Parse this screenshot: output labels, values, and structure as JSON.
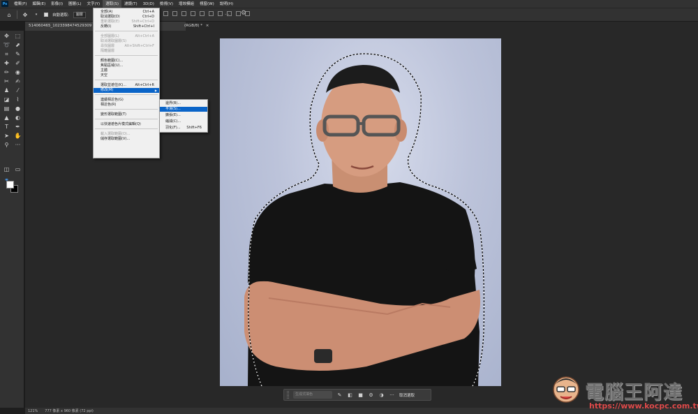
{
  "app": {
    "logo": "Ps"
  },
  "menubar": {
    "items": [
      "檔案(F)",
      "編輯(E)",
      "影像(I)",
      "圖層(L)",
      "文字(Y)",
      "選取(S)",
      "濾鏡(T)",
      "3D(D)",
      "檢視(V)",
      "增效模組",
      "視窗(W)",
      "說明(H)"
    ]
  },
  "options": {
    "auto_select_label": "自動選取:",
    "auto_select_value": "圖層"
  },
  "document": {
    "tab_title": "514060465_1023398474529309 4_7",
    "tab_suffix": "(RGB/8) *",
    "close_glyph": "×"
  },
  "select_menu": {
    "items": [
      {
        "label": "全部(A)",
        "shortcut": "Ctrl+A",
        "enabled": true
      },
      {
        "label": "取消選取(D)",
        "shortcut": "Ctrl+D",
        "enabled": true
      },
      {
        "label": "重新選取(E)",
        "shortcut": "Shift+Ctrl+D",
        "enabled": false
      },
      {
        "label": "反轉(I)",
        "shortcut": "Shift+Ctrl+I",
        "enabled": true
      },
      {
        "label": "全部圖層(L)",
        "shortcut": "Alt+Ctrl+A",
        "enabled": false
      },
      {
        "label": "取消選取圖層(S)",
        "shortcut": "",
        "enabled": false
      },
      {
        "label": "尋找圖層",
        "shortcut": "Alt+Shift+Ctrl+F",
        "enabled": false
      },
      {
        "label": "隔離圖層",
        "shortcut": "",
        "enabled": false
      },
      {
        "label": "顏色範圍(C)...",
        "shortcut": "",
        "enabled": true
      },
      {
        "label": "焦點區域(U)...",
        "shortcut": "",
        "enabled": true
      },
      {
        "label": "主體",
        "shortcut": "",
        "enabled": true
      },
      {
        "label": "天空",
        "shortcut": "",
        "enabled": true
      },
      {
        "label": "選取並遮住(K)...",
        "shortcut": "Alt+Ctrl+R",
        "enabled": true
      },
      {
        "label": "修改(M)",
        "shortcut": "",
        "enabled": true,
        "has_submenu": true
      },
      {
        "label": "連續相近色(G)",
        "shortcut": "",
        "enabled": true
      },
      {
        "label": "相近色(R)",
        "shortcut": "",
        "enabled": true
      },
      {
        "label": "變形選取範圍(T)",
        "shortcut": "",
        "enabled": true
      },
      {
        "label": "以快速遮色片模式編輯(Q)",
        "shortcut": "",
        "enabled": true
      },
      {
        "label": "載入選取範圍(O)...",
        "shortcut": "",
        "enabled": false
      },
      {
        "label": "儲存選取範圍(V)...",
        "shortcut": "",
        "enabled": true
      }
    ]
  },
  "modify_submenu": {
    "items": [
      {
        "label": "邊界(B)...",
        "shortcut": ""
      },
      {
        "label": "平滑(S)...",
        "shortcut": ""
      },
      {
        "label": "擴張(E)...",
        "shortcut": ""
      },
      {
        "label": "縮減(C)...",
        "shortcut": ""
      },
      {
        "label": "羽化(F)...",
        "shortcut": "Shift+F6"
      }
    ]
  },
  "statusbar": {
    "zoom": "121%",
    "doc_info": "777 像素 x 960 像素 (72 ppi)"
  },
  "taskbar": {
    "generative_fill": "生成式填色",
    "deselect": "取消選取"
  },
  "watermark": {
    "title": "電腦王阿達",
    "url": "https://www.kocpc.com.tw"
  },
  "icons": {
    "home": "home-icon",
    "move": "move-icon",
    "gear": "gear-icon"
  }
}
